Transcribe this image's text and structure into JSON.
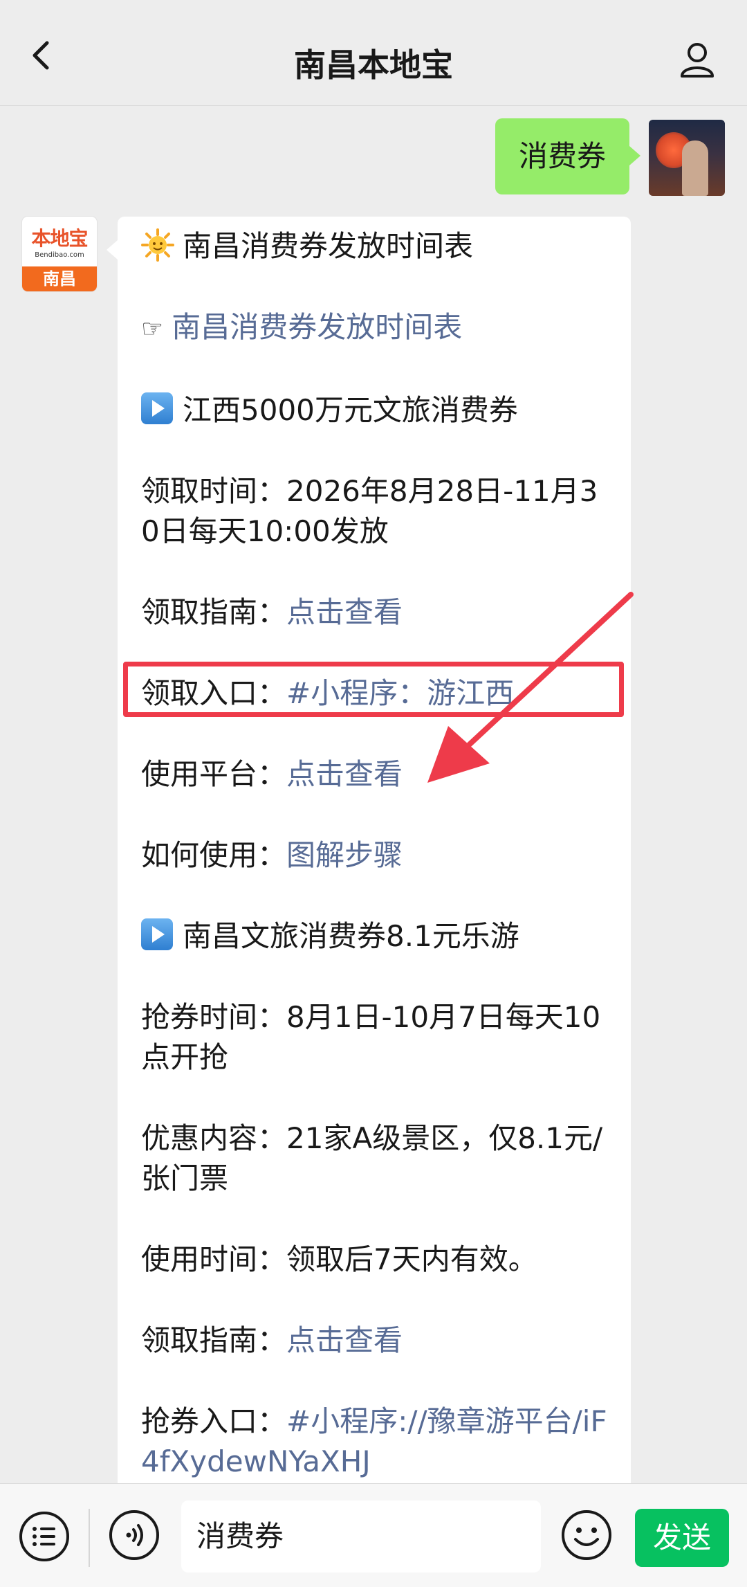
{
  "header": {
    "title": "南昌本地宝",
    "back_icon": "chevron-left-icon",
    "profile_icon": "person-icon"
  },
  "user_message": {
    "text": "消费券"
  },
  "bot_avatar": {
    "brand": "本地宝",
    "site": "Bendibao.com",
    "city": "南昌"
  },
  "bot_message": {
    "title": "南昌消费券发放时间表",
    "link_title": "南昌消费券发放时间表",
    "section1_heading": "江西5000万元文旅消费券",
    "s1_time_label": "领取时间：",
    "s1_time_value": "2026年8月28日-11月30日每天10:00发放",
    "s1_guide_label": "领取指南：",
    "s1_guide_link": "点击查看",
    "s1_entry_label": "领取入口：",
    "s1_entry_link": "#小程序：游江西",
    "s1_platform_label": "使用平台：",
    "s1_platform_link": "点击查看",
    "s1_howto_label": "如何使用：",
    "s1_howto_link": "图解步骤",
    "section2_heading": "南昌文旅消费券8.1元乐游",
    "s2_time_label": "抢券时间：",
    "s2_time_value": "8月1日-10月7日每天10点开抢",
    "s2_offer_label": "优惠内容：",
    "s2_offer_value": "21家A级景区，仅8.1元/张门票",
    "s2_valid_label": "使用时间：",
    "s2_valid_value": "领取后7天内有效。",
    "s2_guide_label": "领取指南：",
    "s2_guide_link": "点击查看",
    "s2_entry_label": "抢券入口：",
    "s2_entry_link": "#小程序://豫章游平台/iF4fXydewNYaXHJ"
  },
  "bottom_bar": {
    "input_value": "消费券",
    "send_label": "发送",
    "menu_icon": "menu-list-icon",
    "voice_icon": "voice-icon",
    "emoji_icon": "emoji-icon"
  },
  "colors": {
    "user_bubble": "#95ec69",
    "link": "#576b95",
    "highlight": "#ee3b4a",
    "send_button": "#07c160"
  }
}
